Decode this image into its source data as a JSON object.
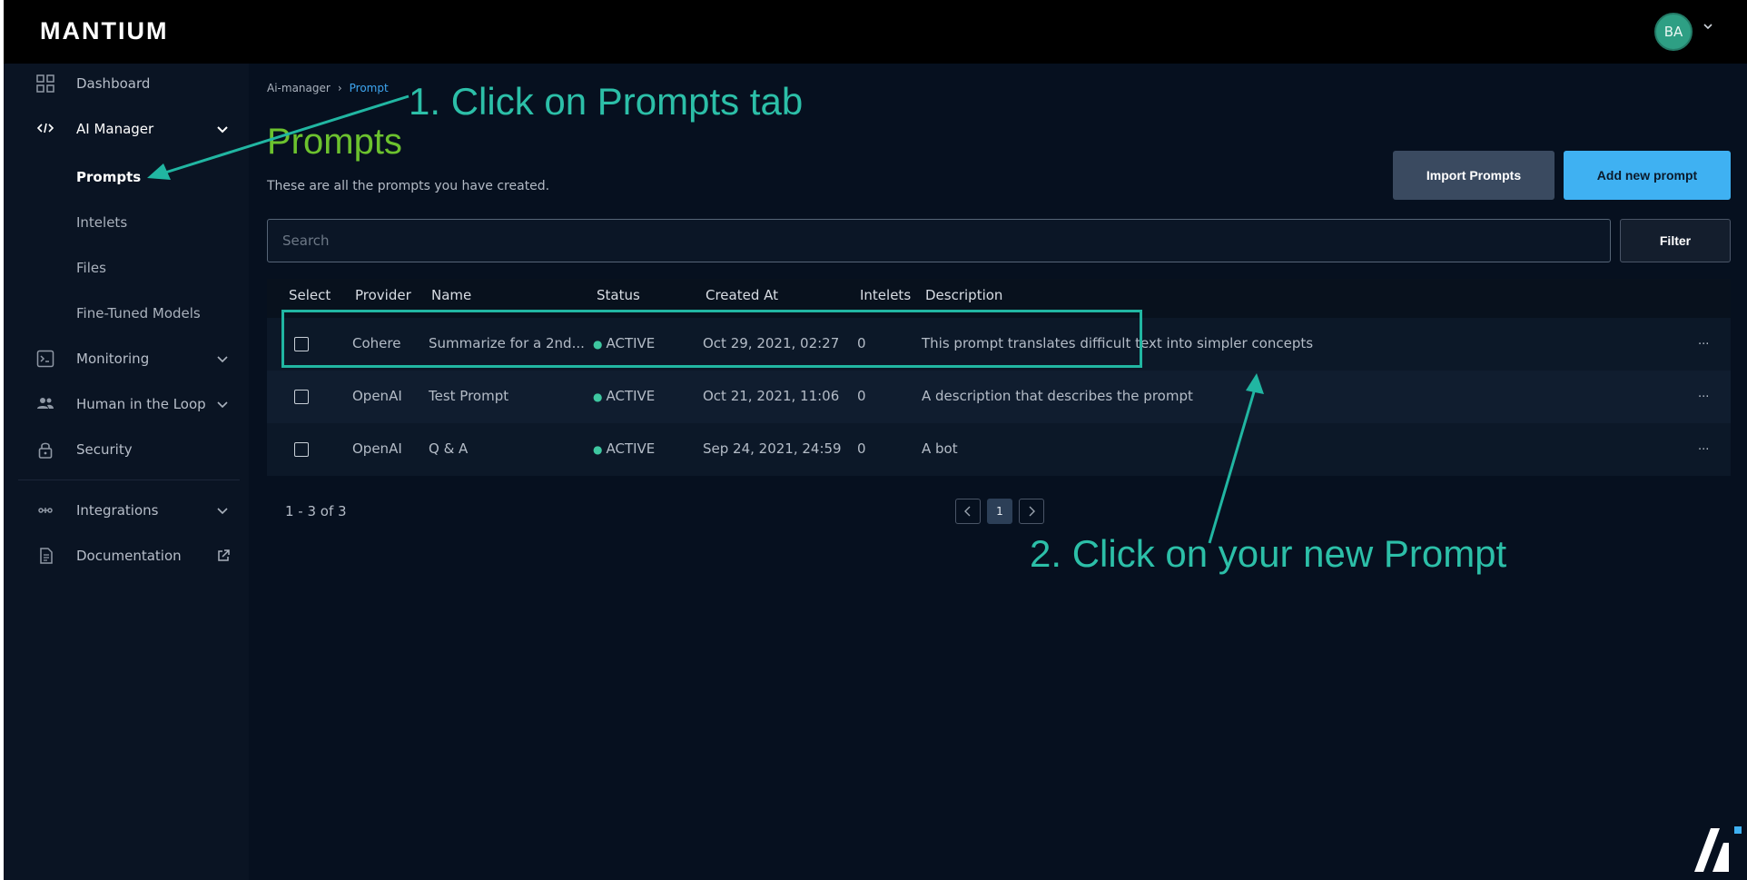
{
  "app": {
    "logo": "MANTIUM",
    "avatar_initials": "BA"
  },
  "sidebar": {
    "items": [
      {
        "label": "Dashboard",
        "icon": "grid-icon"
      },
      {
        "label": "AI Manager",
        "icon": "code-icon",
        "expanded": true
      },
      {
        "label": "Monitoring",
        "icon": "terminal-icon"
      },
      {
        "label": "Human in the Loop",
        "icon": "people-icon"
      },
      {
        "label": "Security",
        "icon": "lock-icon"
      },
      {
        "label": "Integrations",
        "icon": "integrations-icon"
      },
      {
        "label": "Documentation",
        "icon": "document-icon"
      }
    ],
    "ai_manager_sub": [
      "Prompts",
      "Intelets",
      "Files",
      "Fine-Tuned Models"
    ],
    "active_sub": "Prompts"
  },
  "breadcrumb": {
    "parent": "Ai-manager",
    "separator": "›",
    "current": "Prompt"
  },
  "page": {
    "title": "Prompts",
    "subtitle": "These are all the prompts you have created."
  },
  "actions": {
    "import_label": "Import Prompts",
    "add_label": "Add new prompt",
    "filter_label": "Filter"
  },
  "search": {
    "placeholder": "Search",
    "value": ""
  },
  "table": {
    "columns": [
      "Select",
      "Provider",
      "Name",
      "Status",
      "Created At",
      "Intelets",
      "Description"
    ],
    "rows": [
      {
        "provider": "Cohere",
        "name": "Summarize for a 2nd...",
        "status": "ACTIVE",
        "created_at": "Oct 29, 2021, 02:27",
        "intelets": "0",
        "description": "This prompt translates difficult text into simpler concepts",
        "more": "..."
      },
      {
        "provider": "OpenAI",
        "name": "Test Prompt",
        "status": "ACTIVE",
        "created_at": "Oct 21, 2021, 11:06",
        "intelets": "0",
        "description": "A description that describes the prompt",
        "more": "..."
      },
      {
        "provider": "OpenAI",
        "name": "Q & A",
        "status": "ACTIVE",
        "created_at": "Sep 24, 2021, 24:59",
        "intelets": "0",
        "description": "A bot",
        "more": "..."
      }
    ]
  },
  "pagination": {
    "summary": "1 - 3 of 3",
    "current_page": "1"
  },
  "annotations": {
    "step1": "1. Click on Prompts tab",
    "step2": "2. Click on your new Prompt"
  },
  "colors": {
    "accent": "#3fb1f2",
    "title": "#6cc22e",
    "annotation": "#2cbfa8",
    "status_active": "#3ec7a0"
  }
}
